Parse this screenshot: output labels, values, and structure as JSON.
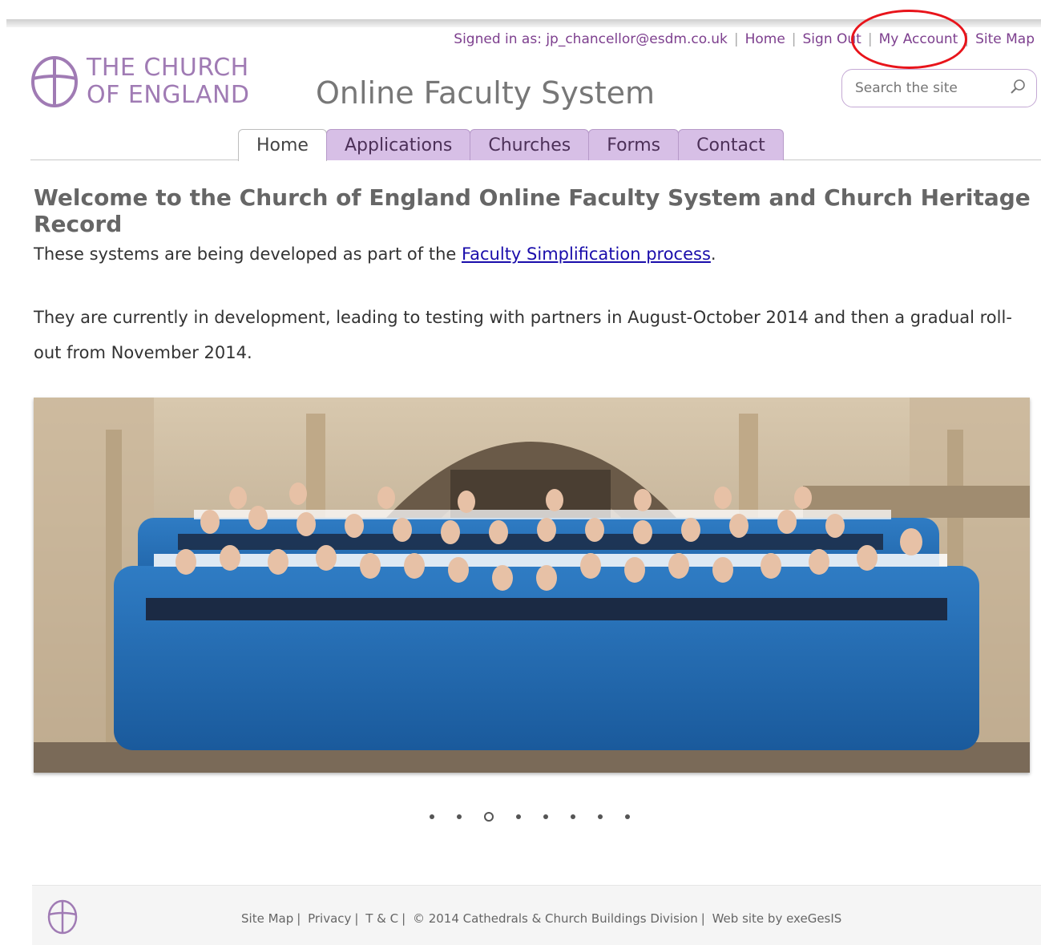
{
  "header": {
    "signed_in_label": "Signed in as: jp_chancellor@esdm.co.uk",
    "links": [
      "Home",
      "Sign Out",
      "My Account",
      "Site Map"
    ],
    "logo_line1": "THE CHURCH",
    "logo_line2": "OF ENGLAND",
    "site_title": "Online Faculty System",
    "search_placeholder": "Search the site"
  },
  "nav": {
    "tabs": [
      "Home",
      "Applications",
      "Churches",
      "Forms",
      "Contact"
    ],
    "active": "Home"
  },
  "main": {
    "heading": "Welcome to the Church of England Online Faculty System and Church Heritage Record",
    "p1_prefix": "These systems are being developed as part of the ",
    "p1_link": "Faculty Simplification process",
    "p1_suffix": ".",
    "p2": "They are currently in development, leading to testing with partners in August-October 2014 and then a gradual roll-out from November 2014."
  },
  "carousel": {
    "slide_count": 8,
    "active_index": 2
  },
  "footer": {
    "links": [
      "Site Map",
      "Privacy",
      "T & C"
    ],
    "copyright": "© 2014 Cathedrals & Church Buildings Division",
    "credit": "Web site by exeGesIS"
  },
  "colors": {
    "brand_purple": "#a07bb4",
    "tab_fill": "#d7bfe6",
    "highlight_ring": "#e8141b",
    "link_blue": "#1a0dab"
  }
}
